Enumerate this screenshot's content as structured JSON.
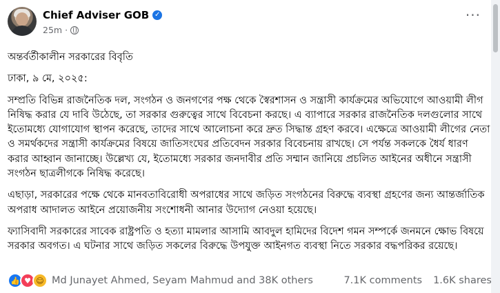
{
  "post": {
    "page_name": "Chief Adviser GOB",
    "time": "25m",
    "separator": "·",
    "more_label": "···",
    "title": "অন্তর্বর্তীকালীন সরকারের বিবৃতি",
    "dateline": "ঢাকা, ৯ মে, ২০২৫:",
    "paragraphs": [
      "সম্প্রতি বিভিন্ন রাজনৈতিক দল, সংগঠন ও জনগণের পক্ষ থেকে স্বৈরশাসন ও সন্ত্রাসী কার্যক্রমের অভিযোগে আওয়ামী লীগ নিষিদ্ধ করার যে দাবি উঠেছে, তা সরকার গুরুত্বের সাথে বিবেচনা করছে। এ ব্যাপারে সরকার রাজনৈতিক দলগুলোর সাথে ইতোমধ্যে যোগাযোগ স্থাপন করেছে, তাদের সাথে আলোচনা করে দ্রুত সিদ্ধান্ত গ্রহণ করবে। এক্ষেত্রে আওয়ামী লীগের নেতা ও সমর্থকদের সন্ত্রাসী কার্যক্রমের বিষয়ে জাতিসংঘের প্রতিবেদন সরকার বিবেচনায় রাখছে। সে পর্যন্ত সকলকে ধৈর্য ধারণ করার আহ্বান জানাচ্ছে। উল্লেখ্য যে, ইতোমধ্যে সরকার জনদাবীর প্রতি সম্মান জানিয়ে প্রচলিত আইনের অধীনে সন্ত্রাসী সংগঠন ছাত্রলীগকে নিষিদ্ধ করেছে।",
      "এছাড়া, সরকারের পক্ষে থেকে মানবতাবিরোধী অপরাধের সাথে জড়িত সংগঠনের বিরুদ্ধে ব্যবস্থা গ্রহণের জন্য আন্তর্জাতিক অপরাধ আদালত আইনে প্রয়োজনীয় সংশোধনী আনার উদ্যোগ নেওয়া হয়েছে।",
      "ফ্যাসিবাদী সরকারের সাবেক রাষ্ট্রপতি ও হত্যা মামলার আসামি আবদুল হামিদের বিদেশ গমন সম্পর্কে জনমনে ক্ষোভ বিষয়ে সরকার অবগত। এ ঘটনার সাথে জড়িত সকলের বিরুদ্ধে উপযুক্ত আইনগত ব্যবস্থা নিতে সরকার বদ্ধপরিকর রয়েছে।"
    ],
    "reactions": {
      "icons": [
        "like-icon",
        "love-icon",
        "haha-icon"
      ],
      "names": "Md Junayet Ahmed, Seyam Mahmud and 38K others",
      "comments": "7.1K comments",
      "shares": "1.6K shares"
    }
  },
  "colors": {
    "verified": "#1b74e4",
    "like": "#1877f2",
    "love": "#f33e58",
    "haha": "#f7b928",
    "meta_text": "#65676b"
  }
}
